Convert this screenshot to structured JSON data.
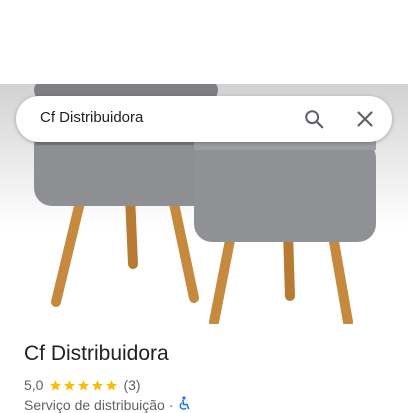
{
  "search": {
    "query": "Cf Distribuidora"
  },
  "place": {
    "name": "Cf Distribuidora",
    "rating": "5,0",
    "stars": 5,
    "review_count": "(3)",
    "category": "Serviço de distribuição",
    "separator": "·"
  },
  "colors": {
    "star": "#fbbc04",
    "accessible_icon": "#1a73e8",
    "title": "#202124",
    "secondary_text": "#5f6368"
  },
  "icons": {
    "search": "search-icon",
    "close": "close-icon",
    "accessible": "wheelchair-icon"
  }
}
